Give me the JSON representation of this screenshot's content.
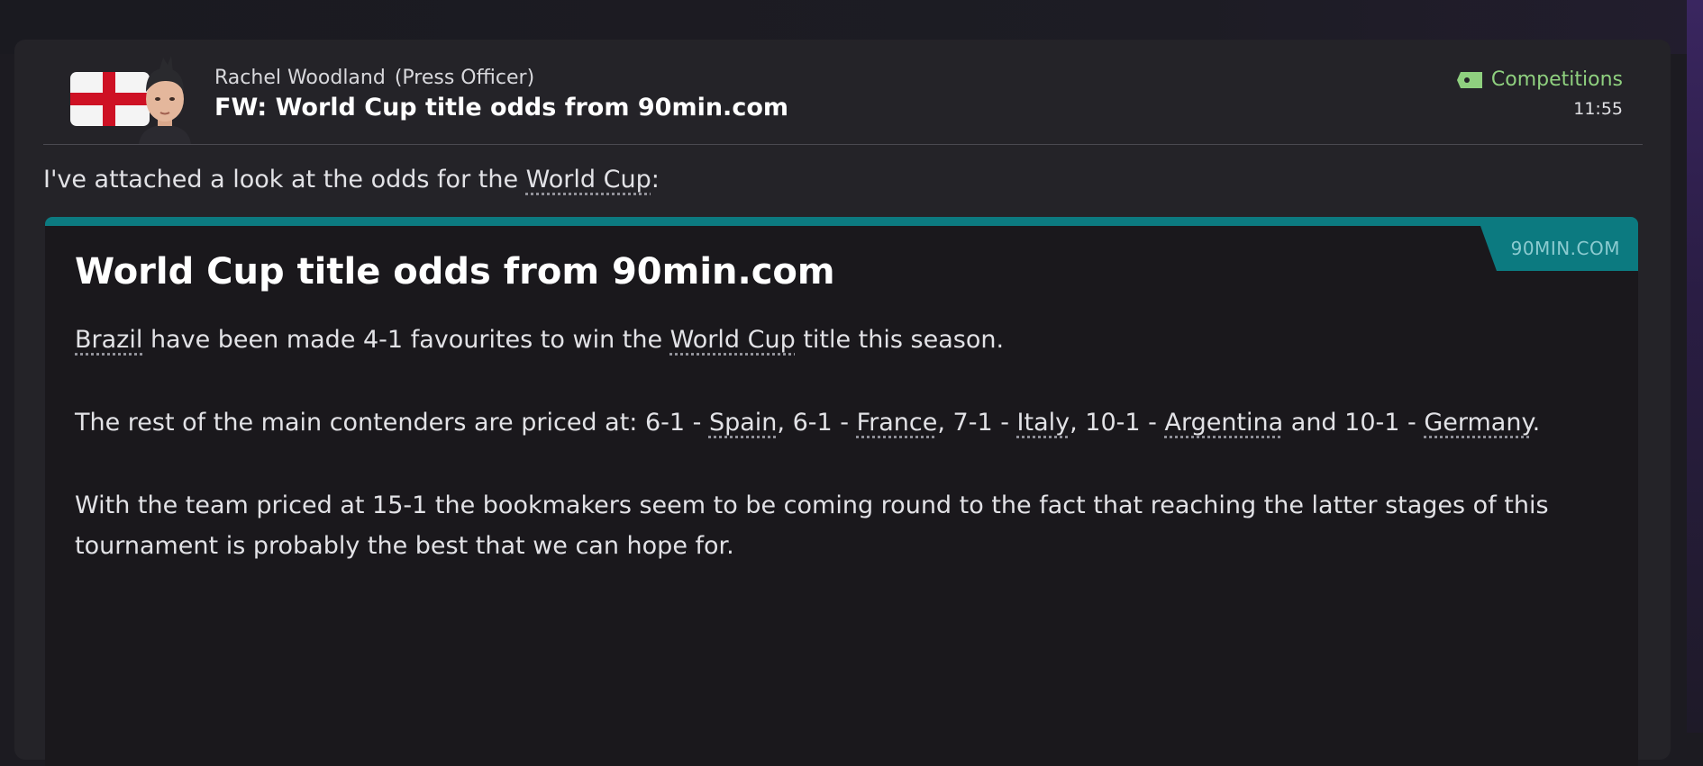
{
  "message": {
    "sender_name": "Rachel Woodland",
    "sender_role": "(Press Officer)",
    "subject": "FW: World Cup title odds from 90min.com",
    "category": "Competitions",
    "category_icon": "ticket-icon",
    "time": "11:55",
    "flag": "england-flag",
    "intro_before": "I've attached a look at the odds for the",
    "intro_link": "World Cup",
    "intro_after": ":"
  },
  "article": {
    "source": "90MIN.COM",
    "title": "World Cup title odds from 90min.com",
    "p1": {
      "link1": "Brazil",
      "text1": " have been made 4-1 favourites to win the ",
      "link2": "World Cup",
      "text2": " title this season."
    },
    "p2": {
      "text1": "The rest of the main contenders are priced at: 6-1 - ",
      "link1": "Spain",
      "text2": ", 6-1 - ",
      "link2": "France",
      "text3": ", 7-1 - ",
      "link3": "Italy",
      "text4": ", 10-1 - ",
      "link4": "Argentina",
      "text5": " and 10-1 - ",
      "link5": "Germany",
      "text6": "."
    },
    "p3": "With the team priced at 15-1 the bookmakers seem to be coming round to the fact that reaching the latter stages of this tournament is probably the best that we can hope for."
  },
  "colors": {
    "accent_teal": "#0c7a80",
    "tag_green": "#8fd07f",
    "flag_red": "#ce1124"
  }
}
